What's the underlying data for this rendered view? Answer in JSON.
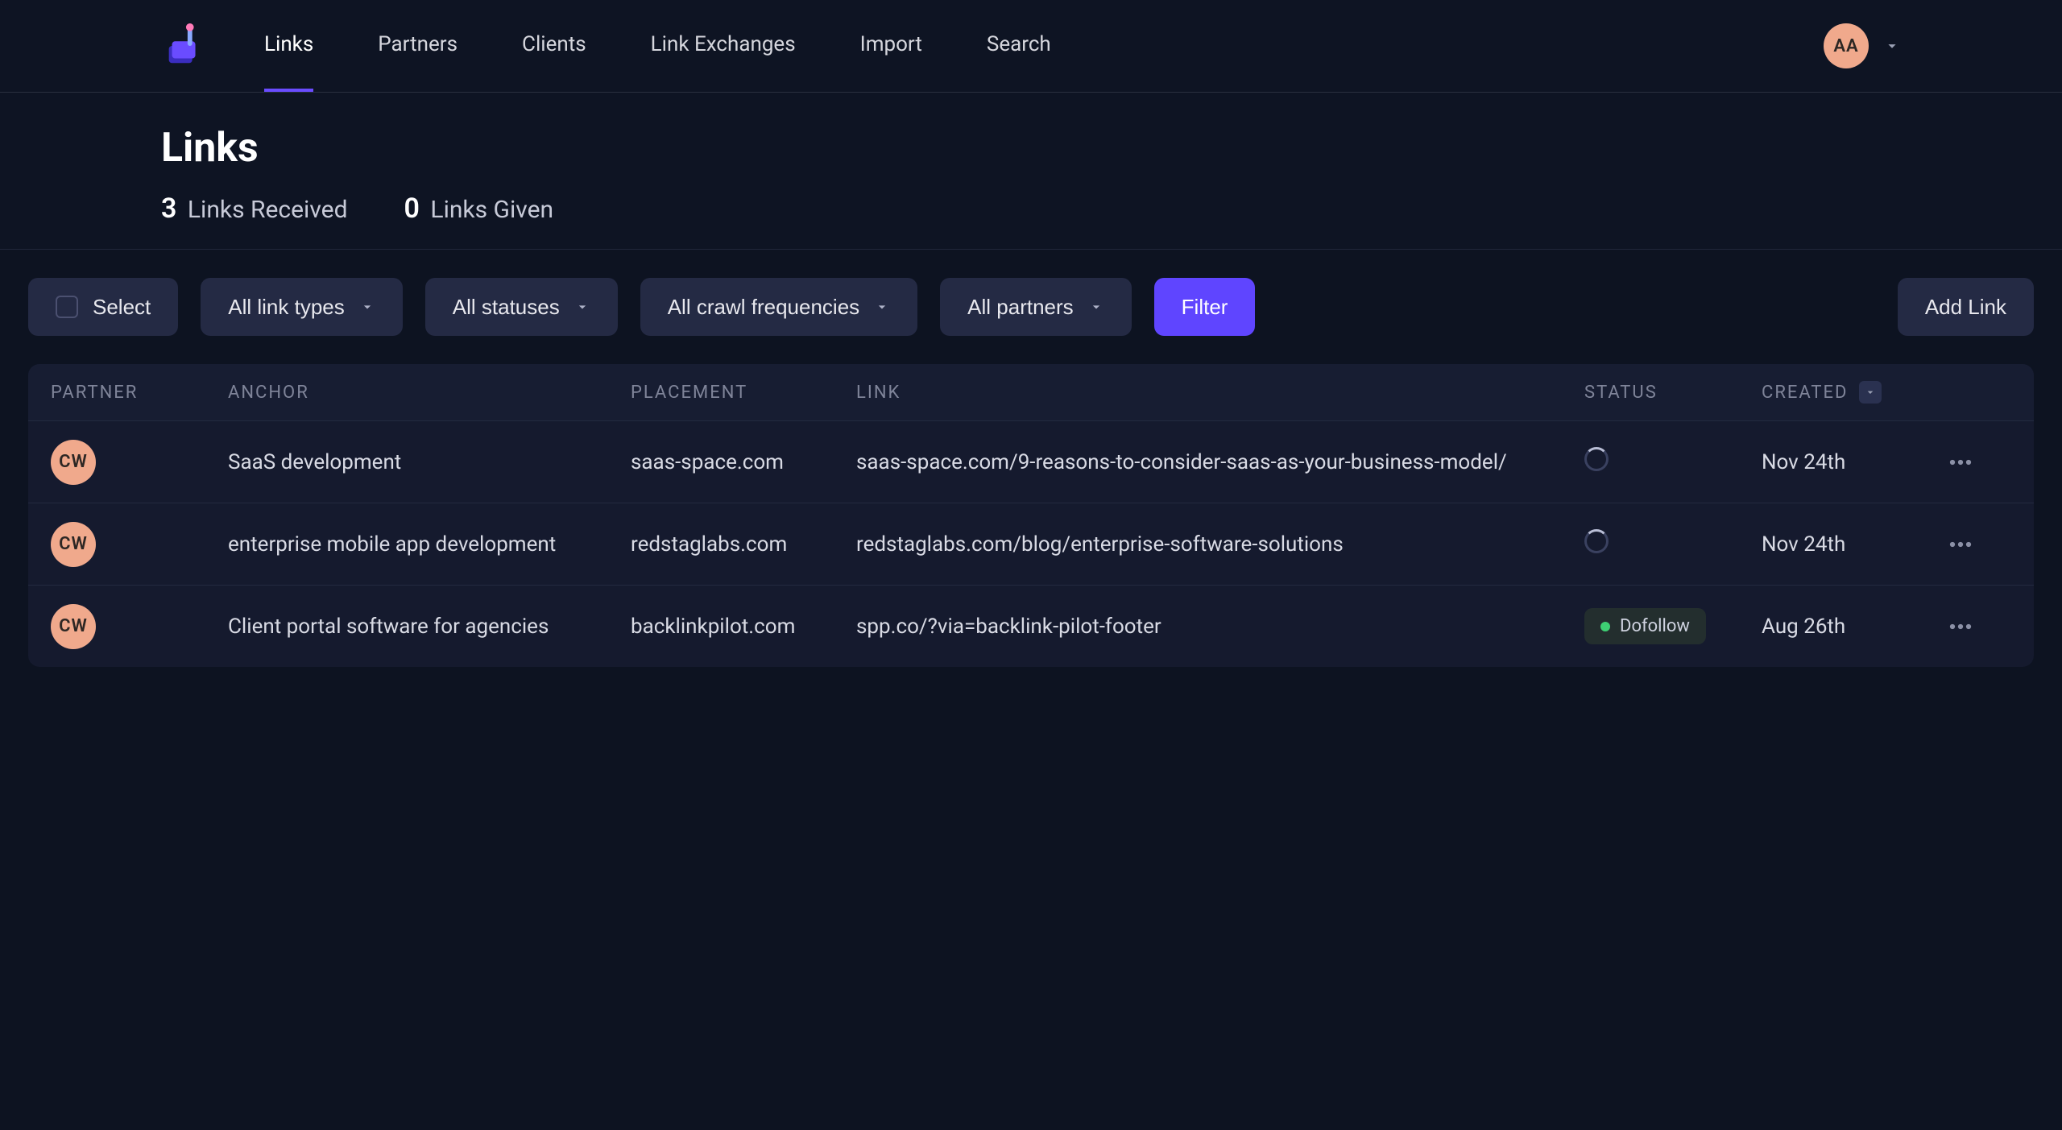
{
  "user": {
    "initials": "AA"
  },
  "nav": {
    "items": [
      {
        "label": "Links",
        "active": true
      },
      {
        "label": "Partners",
        "active": false
      },
      {
        "label": "Clients",
        "active": false
      },
      {
        "label": "Link Exchanges",
        "active": false
      },
      {
        "label": "Import",
        "active": false
      },
      {
        "label": "Search",
        "active": false
      }
    ]
  },
  "page": {
    "title": "Links"
  },
  "tabs": {
    "received": {
      "count": "3",
      "label": "Links Received"
    },
    "given": {
      "count": "0",
      "label": "Links Given"
    }
  },
  "toolbar": {
    "select_label": "Select",
    "link_types_label": "All link types",
    "statuses_label": "All statuses",
    "crawl_freq_label": "All crawl frequencies",
    "partners_label": "All partners",
    "filter_label": "Filter",
    "add_link_label": "Add Link"
  },
  "table": {
    "columns": {
      "partner": "PARTNER",
      "anchor": "ANCHOR",
      "placement": "PLACEMENT",
      "link": "LINK",
      "status": "STATUS",
      "created": "CREATED"
    },
    "rows": [
      {
        "partner_initials": "CW",
        "anchor": "SaaS development",
        "placement": "saas-space.com",
        "link": "saas-space.com/9-reasons-to-consider-saas-as-your-business-model/",
        "status_type": "loading",
        "status_label": "",
        "created": "Nov 24th"
      },
      {
        "partner_initials": "CW",
        "anchor": "enterprise mobile app development",
        "placement": "redstaglabs.com",
        "link": "redstaglabs.com/blog/enterprise-software-solutions",
        "status_type": "loading",
        "status_label": "",
        "created": "Nov 24th"
      },
      {
        "partner_initials": "CW",
        "anchor": "Client portal software for agencies",
        "placement": "backlinkpilot.com",
        "link": "spp.co/?via=backlink-pilot-footer",
        "status_type": "dofollow",
        "status_label": "Dofollow",
        "created": "Aug 26th"
      }
    ]
  }
}
